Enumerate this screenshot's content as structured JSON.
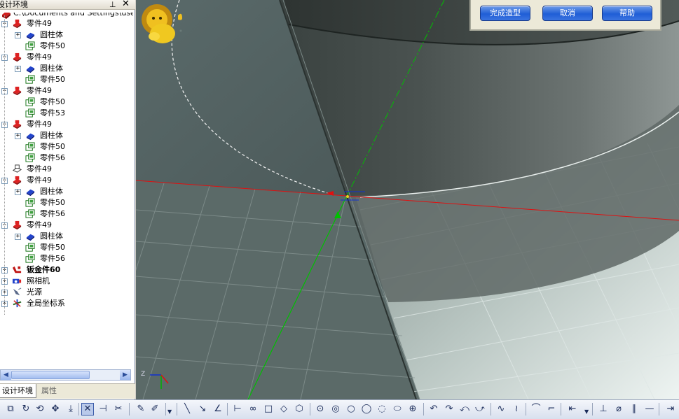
{
  "panel": {
    "title": "设计环境",
    "tabs": {
      "design": "设计环境",
      "properties": "属性"
    }
  },
  "tree": {
    "root_path": "C:\\Documents and Settings\\user\\桌",
    "items": [
      {
        "label": "零件49",
        "icon": "red-part-icon",
        "level": 1,
        "expander": "minus"
      },
      {
        "label": "圆柱体",
        "icon": "blue-cylinder-icon",
        "level": 2,
        "expander": "plus"
      },
      {
        "label": "零件50",
        "icon": "green-part-icon",
        "level": 2,
        "expander": ""
      },
      {
        "label": "零件49",
        "icon": "red-part-icon",
        "level": 1,
        "expander": "minus"
      },
      {
        "label": "圆柱体",
        "icon": "blue-cylinder-icon",
        "level": 2,
        "expander": "plus"
      },
      {
        "label": "零件50",
        "icon": "green-part-icon",
        "level": 2,
        "expander": ""
      },
      {
        "label": "零件49",
        "icon": "red-part-icon",
        "level": 1,
        "expander": "minus"
      },
      {
        "label": "零件50",
        "icon": "green-part-icon",
        "level": 2,
        "expander": ""
      },
      {
        "label": "零件53",
        "icon": "green-part-icon",
        "level": 2,
        "expander": ""
      },
      {
        "label": "零件49",
        "icon": "red-part-icon",
        "level": 1,
        "expander": "minus"
      },
      {
        "label": "圆柱体",
        "icon": "blue-cylinder-icon",
        "level": 2,
        "expander": "plus"
      },
      {
        "label": "零件50",
        "icon": "green-part-icon",
        "level": 2,
        "expander": ""
      },
      {
        "label": "零件56",
        "icon": "green-part-icon",
        "level": 2,
        "expander": ""
      },
      {
        "label": "零件49",
        "icon": "white-part-icon",
        "level": 1,
        "expander": ""
      },
      {
        "label": "零件49",
        "icon": "red-part-icon",
        "level": 1,
        "expander": "minus"
      },
      {
        "label": "圆柱体",
        "icon": "blue-cylinder-icon",
        "level": 2,
        "expander": "plus"
      },
      {
        "label": "零件50",
        "icon": "green-part-icon",
        "level": 2,
        "expander": ""
      },
      {
        "label": "零件56",
        "icon": "green-part-icon",
        "level": 2,
        "expander": ""
      },
      {
        "label": "零件49",
        "icon": "red-part-icon",
        "level": 1,
        "expander": "minus"
      },
      {
        "label": "圆柱体",
        "icon": "blue-cylinder-icon",
        "level": 2,
        "expander": "plus"
      },
      {
        "label": "零件50",
        "icon": "green-part-icon",
        "level": 2,
        "expander": ""
      },
      {
        "label": "零件56",
        "icon": "green-part-icon",
        "level": 2,
        "expander": ""
      },
      {
        "label": "钣金件60",
        "icon": "sheet-metal-icon",
        "level": 1,
        "expander": "plus",
        "bold": true
      },
      {
        "label": "照相机",
        "icon": "camera-icon",
        "level": 1,
        "expander": "plus"
      },
      {
        "label": "光源",
        "icon": "light-icon",
        "level": 1,
        "expander": "plus"
      },
      {
        "label": "全局坐标系",
        "icon": "coordinate-system-icon",
        "level": 1,
        "expander": "plus"
      }
    ]
  },
  "dialog": {
    "finish_label": "完成造型",
    "cancel_label": "取消",
    "help_label": "帮助"
  },
  "viewport": {
    "axis_label_z": "Z"
  },
  "toolbar": {
    "buttons": [
      "rectangle-select-icon",
      "rotate-view-icon",
      "rotate-part-icon",
      "pan-icon",
      "drop-part-icon",
      "crosshair-icon",
      "snap-axis-icon",
      "cut-tool-icon",
      "pencil-icon",
      "pencil-dots-icon",
      "line-icon",
      "tangent-line-icon",
      "angle-line-icon",
      "ortho-line-icon",
      "link-icon",
      "rectangle-icon",
      "diamond-icon",
      "hexagon-icon",
      "circle-center-icon",
      "circle-tangent-icon",
      "circle-three-point-icon",
      "circle-two-point-icon",
      "circle-radius-icon",
      "ellipse-icon",
      "arc-center-icon",
      "arc-icon",
      "arc-three-point-icon",
      "arc-two-point-icon",
      "arc-tangent-icon",
      "spline-icon",
      "curve-icon",
      "fillet-icon",
      "chamfer-icon",
      "dimension-icon",
      "perpendicular-icon",
      "tangent-constraint-icon",
      "parallel-icon",
      "horizontal-icon"
    ]
  },
  "colors": {
    "accent_blue": "#1f5ed6",
    "axis_red": "#e01010",
    "axis_green": "#00c000",
    "part_dark": "#4a5250"
  }
}
